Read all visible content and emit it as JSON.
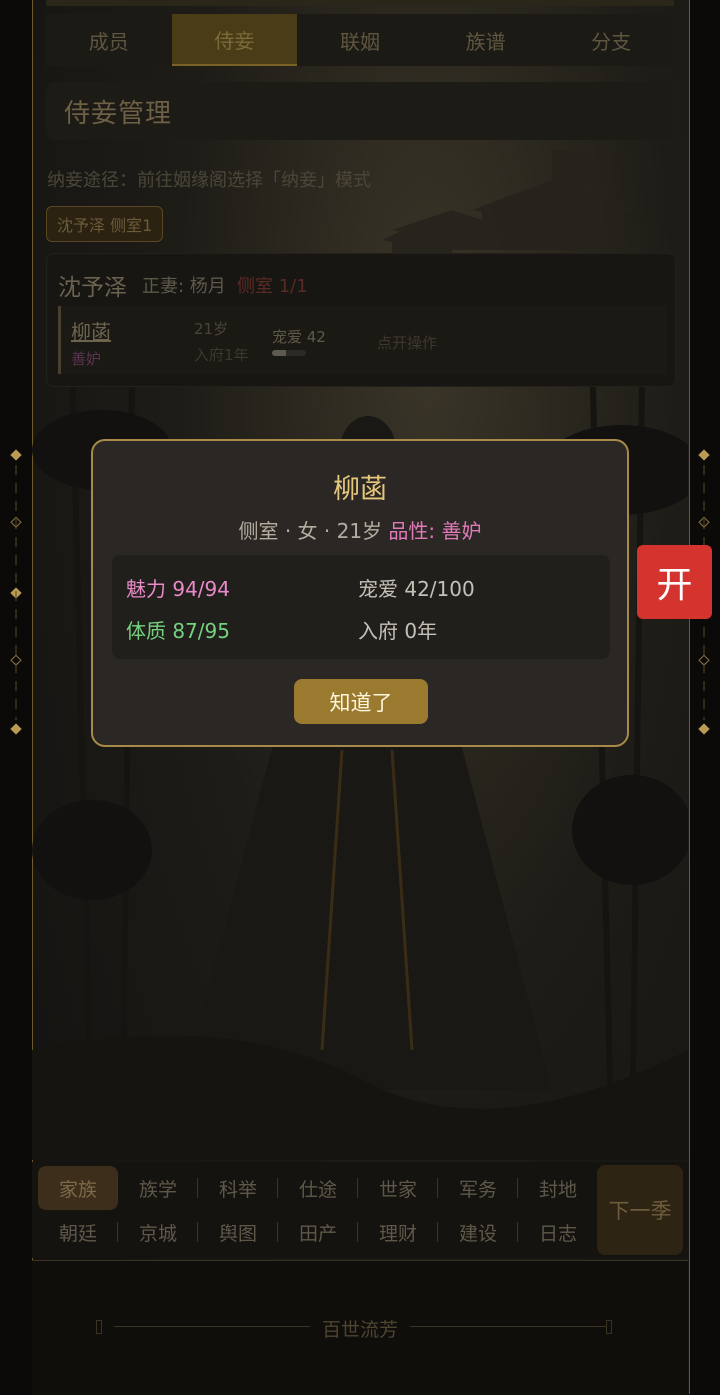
{
  "tabs": [
    {
      "label": "成员",
      "active": false
    },
    {
      "label": "侍妾",
      "active": true
    },
    {
      "label": "联姻",
      "active": false
    },
    {
      "label": "族谱",
      "active": false
    },
    {
      "label": "分支",
      "active": false
    }
  ],
  "section": {
    "title": "侍妾管理",
    "hint": "纳妾途径：前往姻缘阁选择「纳妾」模式",
    "chip": "沈予泽 侧室1"
  },
  "card": {
    "name": "沈予泽",
    "wife": "正妻: 杨月",
    "count": "侧室 1/1",
    "concubine": {
      "name": "柳菡",
      "trait": "善妒",
      "age": "21岁",
      "since": "入府1年",
      "favor_label": "宠爱 42",
      "favor_fraction": 0.42,
      "action": "点开操作"
    }
  },
  "modal": {
    "title": "柳菡",
    "subtitle": "侧室 · 女 · 21岁",
    "trait_label": "品性: 善妒",
    "charm": "魅力 94/94",
    "health": "体质 87/95",
    "favor": "宠爱 42/100",
    "years": "入府 0年",
    "ok": "知道了"
  },
  "float_button": "开",
  "nav": {
    "row1": [
      "家族",
      "族学",
      "科举",
      "仕途",
      "世家",
      "军务",
      "封地"
    ],
    "row2": [
      "朝廷",
      "京城",
      "舆图",
      "田产",
      "理财",
      "建设",
      "日志"
    ],
    "active": "家族",
    "next": "下一季"
  },
  "footer": {
    "brand": "百世流芳"
  },
  "colors": {
    "gold": "#a88a48",
    "accent_red": "#d5342e",
    "trait_pink": "#e07ab8",
    "health_green": "#74d27e"
  }
}
